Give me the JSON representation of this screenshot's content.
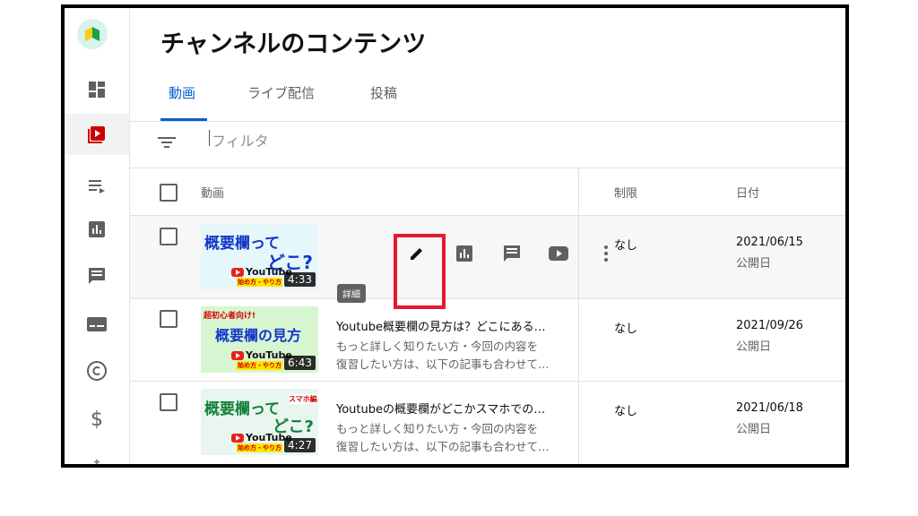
{
  "page": {
    "title": "チャンネルのコンテンツ",
    "tabs": [
      {
        "label": "動画",
        "active": true
      },
      {
        "label": "ライブ配信",
        "active": false
      },
      {
        "label": "投稿",
        "active": false
      }
    ],
    "filter": {
      "placeholder": "フィルタ"
    },
    "columns": {
      "video": "動画",
      "restriction": "制限",
      "date": "日付"
    }
  },
  "sidebar": {
    "items": [
      "dashboard-icon",
      "content-icon",
      "playlist-icon",
      "analytics-icon",
      "comments-icon",
      "subtitles-icon",
      "copyright-icon",
      "monetization-icon",
      "customization-icon"
    ],
    "active": "content-icon"
  },
  "actions": {
    "tooltip": "詳細",
    "icons": [
      "edit-icon",
      "analytics-icon",
      "comments-icon",
      "youtube-icon",
      "more-icon"
    ]
  },
  "videos": [
    {
      "thumb": {
        "line1": "概要欄って",
        "line2": "どこ?",
        "brand": "YouTube",
        "sub": "始め方・やり方"
      },
      "duration": "4:33",
      "title": "",
      "desc1": "",
      "desc2": "",
      "restriction": "なし",
      "date": "2021/06/15",
      "status": "公開日"
    },
    {
      "thumb": {
        "top": "超初心者向け!",
        "line1": "概要欄の見方",
        "brand": "YouTube",
        "sub": "始め方・やり方"
      },
      "duration": "6:43",
      "title": "Youtube概要欄の見方は？どこにある…",
      "desc1": "もっと詳しく知りたい方・今回の内容を",
      "desc2": "復習したい方は、以下の記事も合わせて…",
      "restriction": "なし",
      "date": "2021/09/26",
      "status": "公開日"
    },
    {
      "thumb": {
        "line1": "概要欄って",
        "line2": "どこ?",
        "tag": "スマホ編",
        "brand": "YouTube",
        "sub": "始め方・やり方"
      },
      "duration": "4:27",
      "title": "Youtubeの概要欄がどこかスマホでの…",
      "desc1": "もっと詳しく知りたい方・今回の内容を",
      "desc2": "復習したい方は、以下の記事も合わせて…",
      "restriction": "なし",
      "date": "2021/06/18",
      "status": "公開日"
    }
  ],
  "colors": {
    "accent": "#065fd4",
    "highlight": "#e8192c",
    "youtube": "#e62117"
  }
}
